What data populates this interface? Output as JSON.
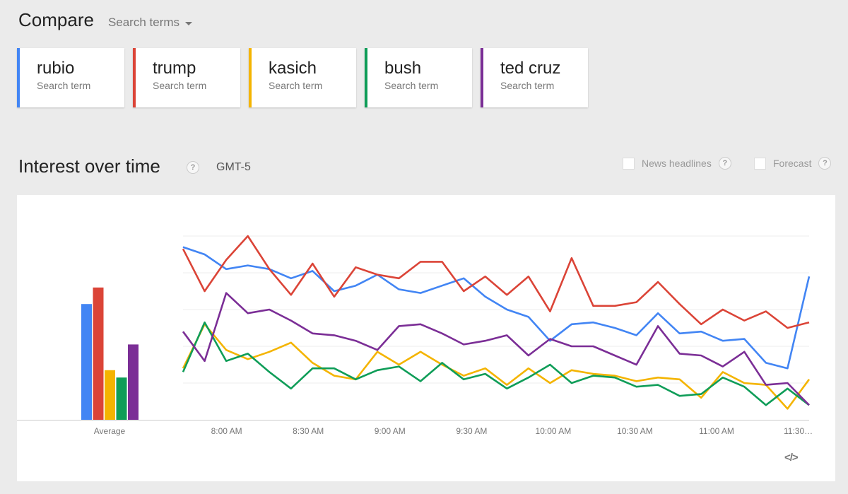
{
  "compare": {
    "title": "Compare",
    "dropdown_label": "Search terms"
  },
  "terms": [
    {
      "name": "rubio",
      "sub": "Search term",
      "color": "#4285f4"
    },
    {
      "name": "trump",
      "sub": "Search term",
      "color": "#db4437"
    },
    {
      "name": "kasich",
      "sub": "Search term",
      "color": "#f4b400"
    },
    {
      "name": "bush",
      "sub": "Search term",
      "color": "#0f9d58"
    },
    {
      "name": "ted cruz",
      "sub": "Search term",
      "color": "#7b2e96"
    }
  ],
  "interest": {
    "title": "Interest over time",
    "help_icon": "?",
    "timezone": "GMT-5",
    "news_label": "News headlines",
    "forecast_label": "Forecast",
    "embed_icon": "</>"
  },
  "chart_data": {
    "type": "line",
    "title": "",
    "xlabel": "",
    "ylabel": "",
    "ylim": [
      0,
      100
    ],
    "grid": true,
    "average_label": "Average",
    "averages": [
      {
        "name": "rubio",
        "value": 63
      },
      {
        "name": "trump",
        "value": 72
      },
      {
        "name": "kasich",
        "value": 27
      },
      {
        "name": "bush",
        "value": 23
      },
      {
        "name": "ted cruz",
        "value": 41
      }
    ],
    "time_minutes": [
      464,
      469,
      474,
      479,
      484,
      489,
      494,
      499,
      504,
      509,
      514,
      519,
      524,
      529,
      534,
      539,
      544,
      549,
      554,
      559,
      564,
      569,
      574,
      579,
      584,
      589,
      594,
      599,
      604,
      609,
      614,
      619,
      624,
      629,
      634,
      639,
      644,
      649,
      654,
      659,
      664,
      669,
      674,
      679,
      684,
      689,
      694
    ],
    "tick_labels": [
      "8:00 AM",
      "8:30 AM",
      "9:00 AM",
      "9:30 AM",
      "10:00 AM",
      "10:30 AM",
      "11:00 AM",
      "11:30…"
    ],
    "tick_minutes": [
      480,
      510,
      540,
      570,
      600,
      630,
      660,
      690
    ],
    "series": [
      {
        "name": "rubio",
        "color": "#4285f4",
        "values": [
          94,
          90,
          82,
          84,
          82,
          77,
          81,
          70,
          73,
          79,
          71,
          69,
          73,
          77,
          67,
          60,
          56,
          43,
          52,
          53,
          50,
          46,
          58,
          47,
          48,
          43,
          44,
          31,
          28,
          78
        ]
      },
      {
        "name": "trump",
        "color": "#db4437",
        "values": [
          93,
          70,
          87,
          100,
          82,
          68,
          85,
          67,
          83,
          79,
          77,
          86,
          86,
          70,
          78,
          68,
          78,
          59,
          88,
          62,
          62,
          64,
          75,
          63,
          52,
          60,
          54,
          59,
          50,
          53
        ]
      },
      {
        "name": "kasich",
        "color": "#f4b400",
        "values": [
          28,
          52,
          38,
          33,
          37,
          42,
          31,
          24,
          22,
          37,
          30,
          37,
          30,
          24,
          28,
          19,
          28,
          20,
          27,
          25,
          24,
          21,
          23,
          22,
          12,
          26,
          20,
          19,
          6,
          22
        ]
      },
      {
        "name": "bush",
        "color": "#0f9d58",
        "values": [
          26,
          53,
          32,
          36,
          26,
          17,
          28,
          28,
          22,
          27,
          29,
          21,
          31,
          22,
          25,
          17,
          23,
          30,
          20,
          24,
          23,
          18,
          19,
          13,
          14,
          23,
          18,
          8,
          17,
          8
        ]
      },
      {
        "name": "ted cruz",
        "color": "#7b2e96",
        "values": [
          48,
          32,
          69,
          58,
          60,
          54,
          47,
          46,
          43,
          38,
          51,
          52,
          47,
          41,
          43,
          46,
          35,
          44,
          40,
          40,
          35,
          30,
          51,
          36,
          35,
          29,
          37,
          19,
          20,
          8
        ]
      }
    ]
  }
}
